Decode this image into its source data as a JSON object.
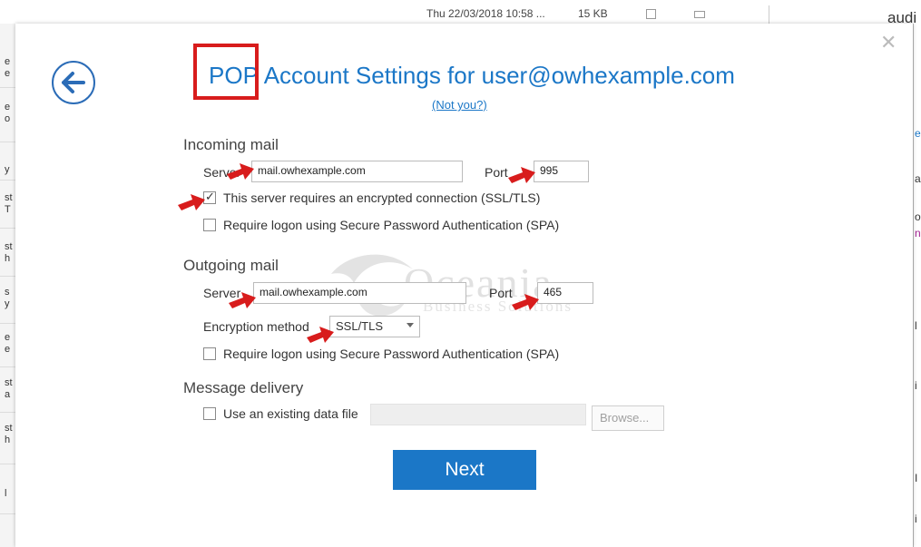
{
  "background": {
    "row_date": "Thu 22/03/2018 10:58 ...",
    "row_size": "15 KB",
    "right_word": "audi"
  },
  "dialog": {
    "title_prefix": "POP",
    "title_rest": "Account Settings for user@owhexample.com",
    "not_you": "(Not you?)",
    "close_icon": "close-icon",
    "back_icon": "back-arrow-icon"
  },
  "incoming": {
    "heading": "Incoming mail",
    "server_label": "Server",
    "server_value": "mail.owhexample.com",
    "port_label": "Port",
    "port_value": "995",
    "ssl_label": "This server requires an encrypted connection (SSL/TLS)",
    "ssl_checked": true,
    "spa_label": "Require logon using Secure Password Authentication (SPA)",
    "spa_checked": false
  },
  "outgoing": {
    "heading": "Outgoing mail",
    "server_label": "Server",
    "server_value": "mail.owhexample.com",
    "port_label": "Port",
    "port_value": "465",
    "encryption_label": "Encryption method",
    "encryption_value": "SSL/TLS",
    "spa_label": "Require logon using Secure Password Authentication (SPA)",
    "spa_checked": false
  },
  "delivery": {
    "heading": "Message delivery",
    "existing_label": "Use an existing data file",
    "existing_checked": false,
    "browse_label": "Browse..."
  },
  "next_label": "Next",
  "watermark": {
    "name": "Oceania",
    "sub": "Business Solutions"
  },
  "colors": {
    "accent": "#1b77c7",
    "highlight_box": "#d81c1c",
    "annotation_arrow": "#d81c1c"
  }
}
